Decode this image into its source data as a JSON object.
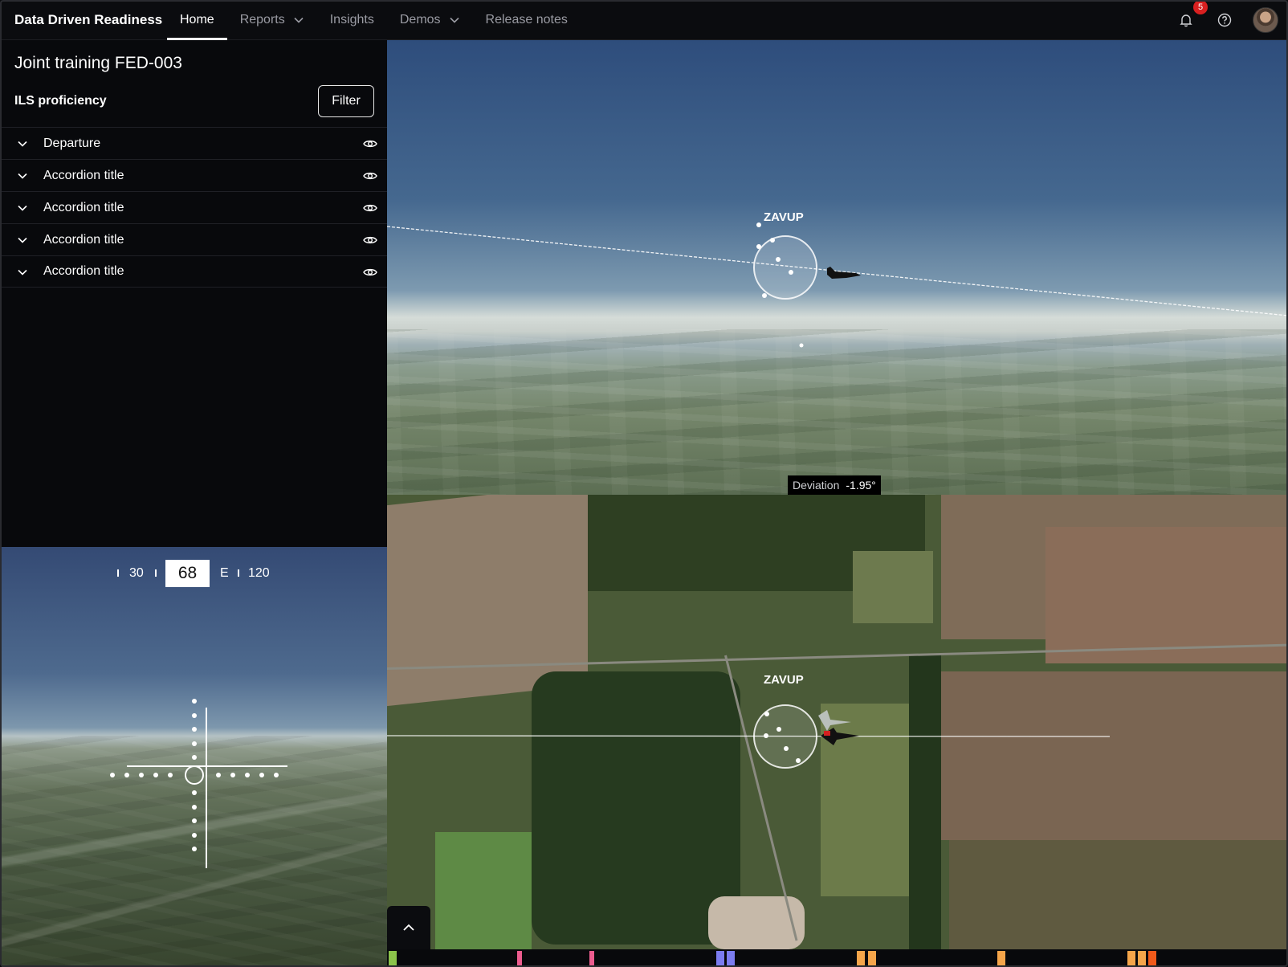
{
  "app": {
    "brand": "Data Driven Readiness",
    "nav": [
      {
        "label": "Home",
        "active": true
      },
      {
        "label": "Reports",
        "dropdown": true
      },
      {
        "label": "Insights"
      },
      {
        "label": "Demos",
        "dropdown": true
      },
      {
        "label": "Release notes"
      }
    ],
    "notifications_count": "5",
    "icons": {
      "notifications": "bell-icon",
      "help": "help-circle-icon",
      "avatar": "user-avatar"
    }
  },
  "panel": {
    "title": "Joint training FED-003",
    "section": "ILS proficiency",
    "filter_label": "Filter",
    "accordion": [
      {
        "label": "Departure"
      },
      {
        "label": "Accordion title"
      },
      {
        "label": "Accordion title"
      },
      {
        "label": "Accordion title"
      },
      {
        "label": "Accordion title"
      }
    ]
  },
  "cockpit": {
    "heading_left": "30",
    "heading_value": "68",
    "heading_cardinal": "E",
    "heading_right": "120"
  },
  "view3d": {
    "waypoint": "ZAVUP",
    "deviation_label": "Deviation",
    "deviation_value": "-1.95°"
  },
  "map": {
    "waypoint": "ZAVUP"
  },
  "timeline": {
    "marker_colors": [
      "#8bc34a",
      "#ec5c8f",
      "#ec5c8f",
      "#7b7cf0",
      "#7b7cf0",
      "#f5a54a",
      "#f5a54a",
      "#f5a54a",
      "#f5a54a",
      "#f5a54a",
      "#f15a1a"
    ]
  },
  "colors": {
    "background": "#08090c",
    "accent_badge": "#d92020"
  }
}
